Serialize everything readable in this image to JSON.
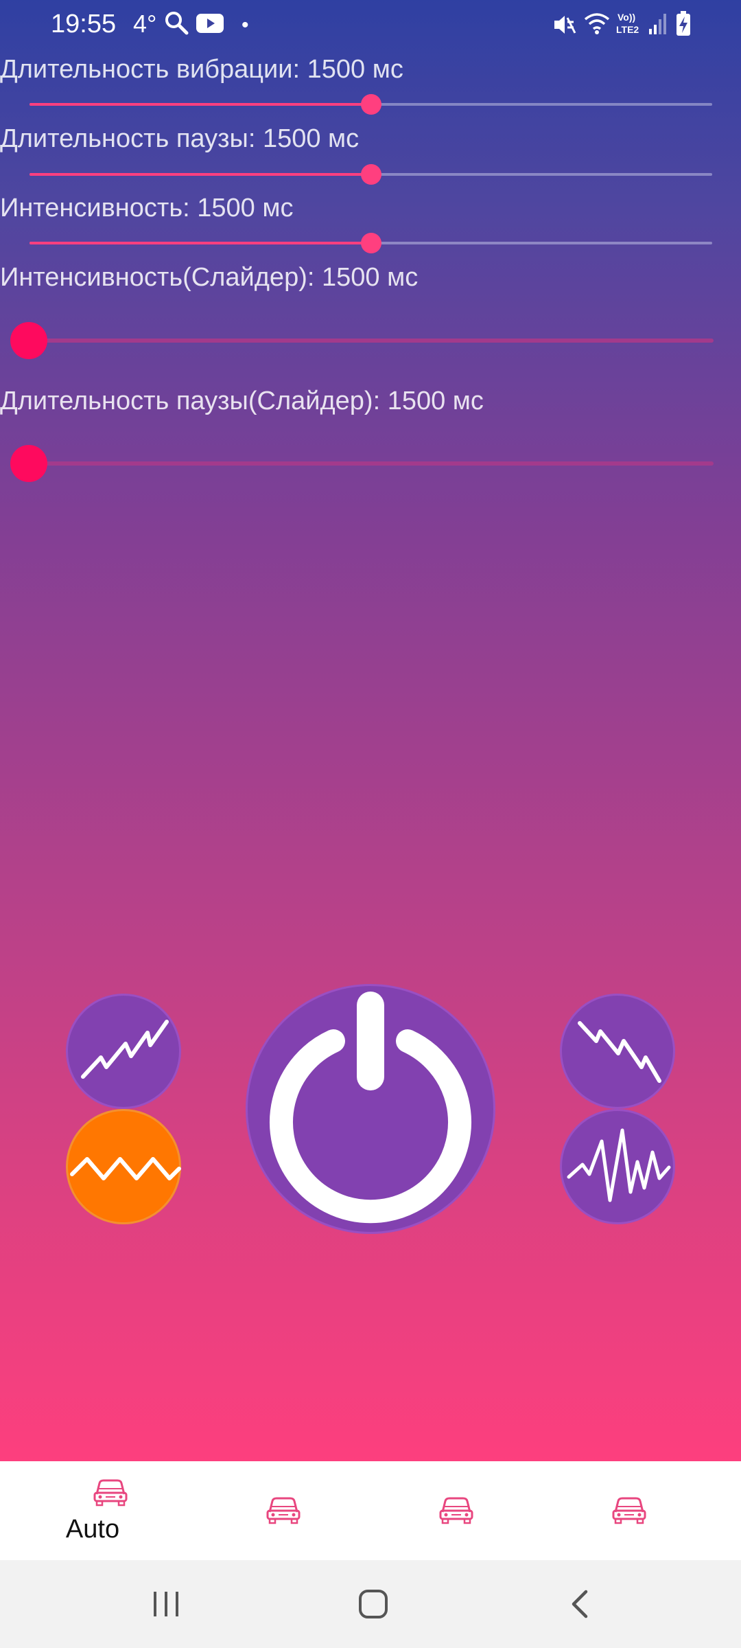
{
  "status_bar": {
    "time": "19:55",
    "temperature": "4°",
    "icons": [
      "search-icon",
      "youtube-icon",
      "dot-icon",
      "mute-icon",
      "wifi-icon",
      "volte-lte2-icon",
      "signal-icon",
      "battery-charging-icon"
    ]
  },
  "sliders": [
    {
      "label": "Длительность вибрации: 1500 мс",
      "value": 0.5
    },
    {
      "label": "Длительность паузы: 1500 мс",
      "value": 0.5
    },
    {
      "label": "Интенсивность: 1500 мс",
      "value": 0.5
    }
  ],
  "custom_sliders": [
    {
      "label": "Интенсивность(Слайдер): 1500 мс",
      "value": 0.0
    },
    {
      "label": "Длительность паузы(Слайдер): 1500 мс",
      "value": 0.0
    }
  ],
  "mode_buttons": {
    "left_top": {
      "icon": "rising-zigzag-icon",
      "active": false
    },
    "left_bottom": {
      "icon": "zigzag-wave-icon",
      "active": true
    },
    "right_top": {
      "icon": "falling-zigzag-icon",
      "active": false
    },
    "right_bottom": {
      "icon": "pulse-wave-icon",
      "active": false
    }
  },
  "power_button": {
    "icon": "power-icon"
  },
  "bottom_nav": {
    "items": [
      {
        "label": "Auto",
        "icon": "car-icon",
        "selected": true
      },
      {
        "label": "",
        "icon": "car-icon",
        "selected": false
      },
      {
        "label": "",
        "icon": "car-icon",
        "selected": false
      },
      {
        "label": "",
        "icon": "car-icon",
        "selected": false
      }
    ]
  },
  "system_nav": [
    "recents-icon",
    "home-icon",
    "back-icon"
  ],
  "colors": {
    "accent": "#ff3f7f",
    "thumb_strong": "#fe0a5e",
    "button_purple": "#8241b0",
    "button_active_orange": "#ff7701",
    "nav_icon": "#e8467f"
  }
}
